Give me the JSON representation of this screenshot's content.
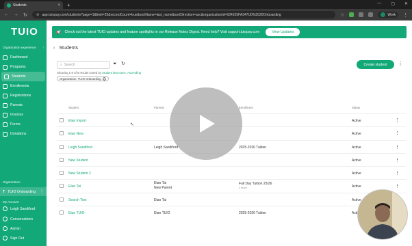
{
  "browser": {
    "tab_title": "Students",
    "url": "app.tuiopay.com/students?page=1&limit=25&recordCount=true&sortName=last_name&sortDirection=asc&organizationId=934105FA347U0%2520Onboarding",
    "profile_name": "Work"
  },
  "sidebar": {
    "logo": "TUIO",
    "org_experience_label": "Organization experience",
    "items": [
      {
        "label": "Dashboard"
      },
      {
        "label": "Programs"
      },
      {
        "label": "Students"
      },
      {
        "label": "Enrollments"
      },
      {
        "label": "Registrations"
      },
      {
        "label": "Parents"
      },
      {
        "label": "Invoices"
      },
      {
        "label": "Forms"
      },
      {
        "label": "Donations"
      }
    ],
    "organization_label": "Organization",
    "organization_name": "TUIO Onboarding",
    "my_account_label": "My Account",
    "account_name": "Leigh Sandiford",
    "account_items": [
      {
        "label": "Conversations"
      },
      {
        "label": "Admin"
      },
      {
        "label": "Sign Out"
      }
    ]
  },
  "banner": {
    "text": "Check out the latest TUIO updates and feature spotlights in our Release Notes Digest. Need help? Visit support.tuiopay.com",
    "button": "View Updates"
  },
  "page": {
    "title": "Students",
    "search_placeholder": "Search",
    "create_button": "Create student",
    "showing_prefix": "Showing 1-8 of 8 results sorted by ",
    "showing_sort": "Student last name",
    "showing_dir": "Ascending",
    "filter_chip": "Organization: TUIO Onboarding"
  },
  "table": {
    "columns": [
      "Student",
      "Parents",
      "Enrollment",
      "Status"
    ],
    "rows": [
      {
        "name": "Etan Import",
        "parents": "",
        "parents2": "",
        "enrollment": "",
        "enrollment_sub": "",
        "status": "Active"
      },
      {
        "name": "Etan New",
        "parents": "",
        "parents2": "",
        "enrollment": "",
        "enrollment_sub": "",
        "status": "Active"
      },
      {
        "name": "Leigh Sandiford",
        "parents": "Leigh Sandiford",
        "parents2": "",
        "enrollment": "2025-2026 Tuition",
        "enrollment_sub": "",
        "status": "Active"
      },
      {
        "name": "New Student",
        "parents": "",
        "parents2": "",
        "enrollment": "",
        "enrollment_sub": "",
        "status": "Active"
      },
      {
        "name": "New Student 2",
        "parents": "",
        "parents2": "",
        "enrollment": "",
        "enrollment_sub": "",
        "status": "Active"
      },
      {
        "name": "Etan Tai",
        "parents": "Etan Tai",
        "parents2": "New Parent",
        "enrollment": "Full Day Tuition 25/26",
        "enrollment_sub": "2 more",
        "status": "Active"
      },
      {
        "name": "Search Test",
        "parents": "Etan Tai",
        "parents2": "",
        "enrollment": "",
        "enrollment_sub": "",
        "status": "Active"
      },
      {
        "name": "Etan TUIO",
        "parents": "Etan TUIO",
        "parents2": "",
        "enrollment": "2025-2026 Tuition",
        "enrollment_sub": "",
        "status": "Active"
      }
    ]
  },
  "colors": {
    "brand": "#13a877",
    "play_overlay": "#969696"
  }
}
